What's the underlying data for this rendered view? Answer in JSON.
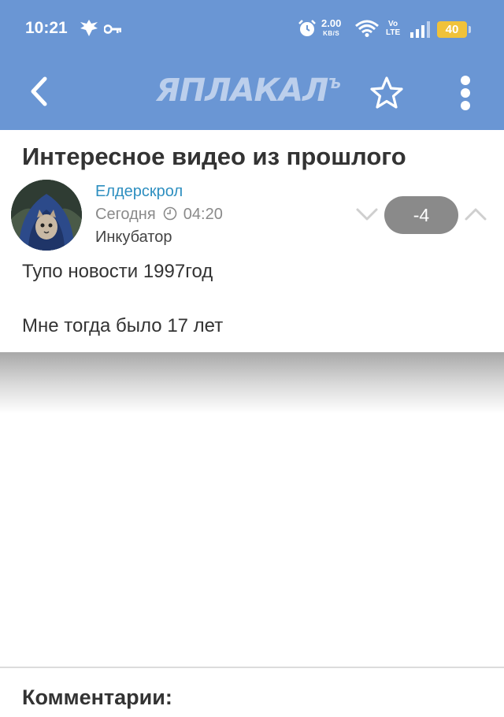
{
  "status_bar": {
    "time": "10:21",
    "net_speed": "2.00",
    "net_unit": "KB/S",
    "volte_top": "Vo",
    "volte_bottom": "LTE",
    "battery": "40"
  },
  "toolbar": {
    "logo": "ЯПЛАКАЛ",
    "logo_suffix": "Ъ",
    "accent_color": "#6a96d4"
  },
  "post": {
    "title": "Интересное видео из прошлого",
    "author": "Елдерскрол",
    "date_label": "Сегодня",
    "time": "04:20",
    "rank": "Инкубатор",
    "score": "-4",
    "body": [
      "Тупо новости 1997год",
      "Мне тогда было 17 лет"
    ]
  },
  "comments": {
    "title": "Комментарии:"
  }
}
